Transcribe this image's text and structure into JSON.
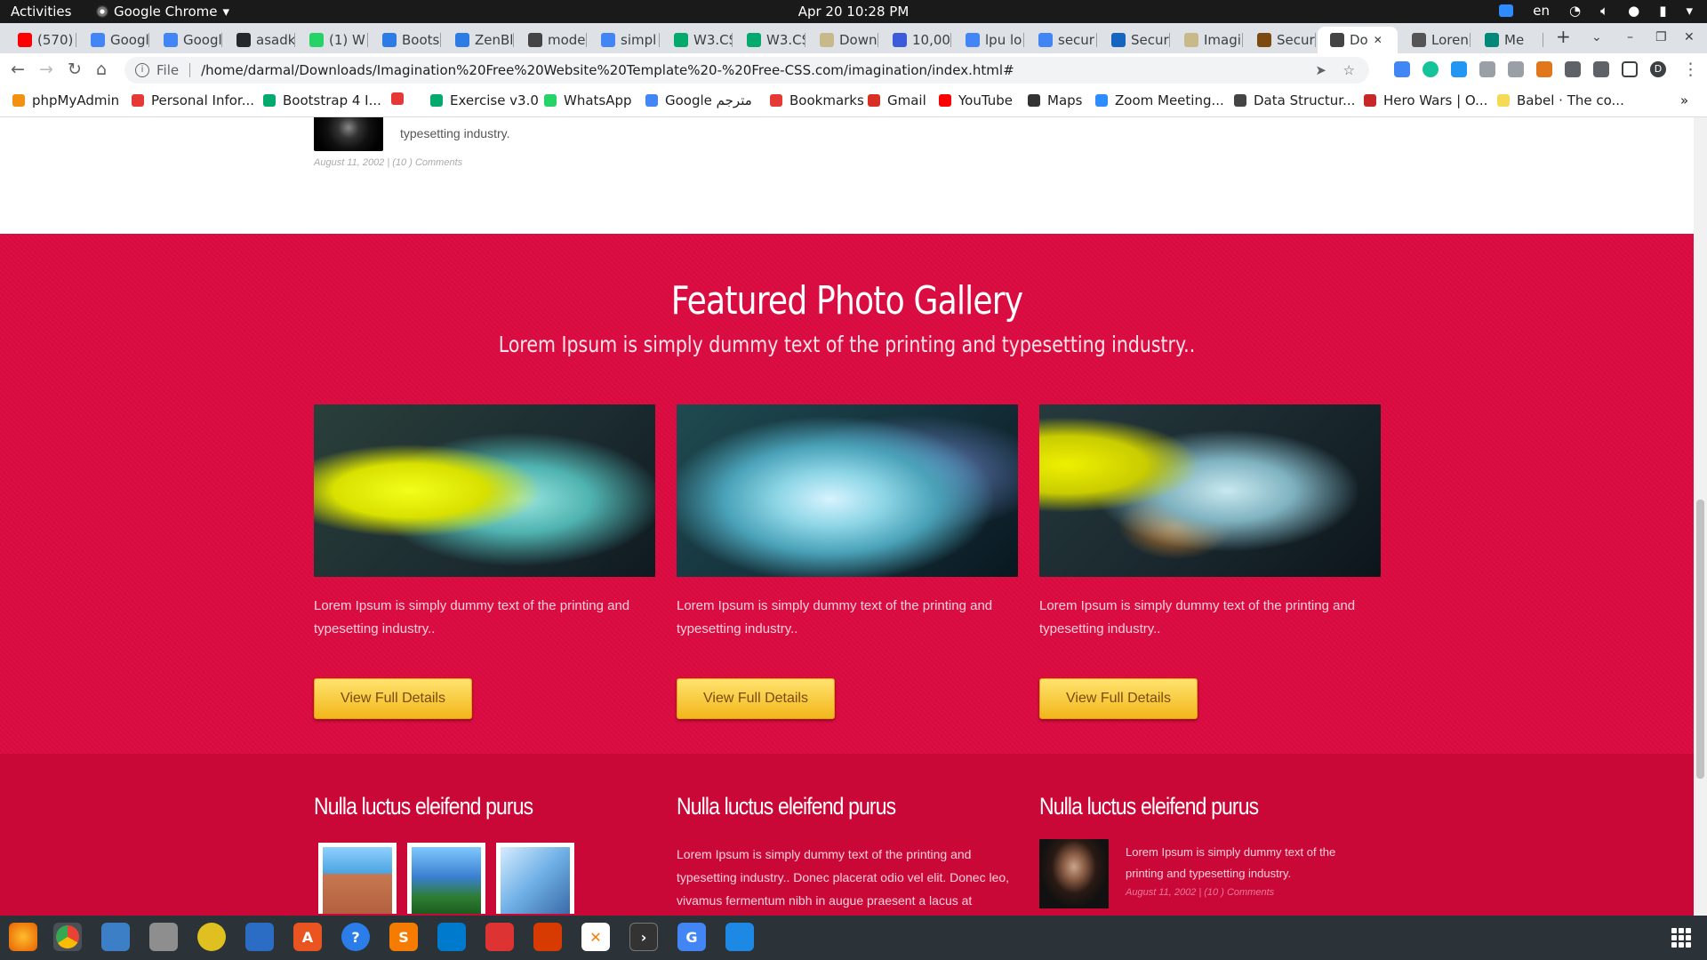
{
  "system": {
    "activities": "Activities",
    "app_name": "Google Chrome",
    "clock": "Apr 20  10:28 PM",
    "lang": "en"
  },
  "tabs": [
    {
      "label": "(570)",
      "fav": "youtube-icon",
      "color": "#ff0000"
    },
    {
      "label": "Googl",
      "fav": "translate-icon",
      "color": "#4285f4"
    },
    {
      "label": "Googl",
      "fav": "translate-icon",
      "color": "#4285f4"
    },
    {
      "label": "asadk",
      "fav": "github-icon",
      "color": "#24292e"
    },
    {
      "label": "(1) W",
      "fav": "whatsapp-icon",
      "color": "#25d366"
    },
    {
      "label": "Boots",
      "fav": "bootstrap-icon",
      "color": "#2d7be5"
    },
    {
      "label": "ZenBl",
      "fav": "zen-icon",
      "color": "#2d7be5"
    },
    {
      "label": "mode",
      "fav": "globe-icon",
      "color": "#444"
    },
    {
      "label": "simpl",
      "fav": "google-icon",
      "color": "#4285f4"
    },
    {
      "label": "W3.CS",
      "fav": "w3-icon",
      "color": "#04aa6d"
    },
    {
      "label": "W3.CS",
      "fav": "w3-icon",
      "color": "#04aa6d"
    },
    {
      "label": "Down",
      "fav": "folder-icon",
      "color": "#c8b98a"
    },
    {
      "label": "10,00",
      "fav": "n-icon",
      "color": "#3b5bdb"
    },
    {
      "label": "lpu lo",
      "fav": "google-icon",
      "color": "#4285f4"
    },
    {
      "label": "secur",
      "fav": "google-icon",
      "color": "#4285f4"
    },
    {
      "label": "Secur",
      "fav": "shield-icon",
      "color": "#1565c0"
    },
    {
      "label": "Imagi",
      "fav": "folder-icon",
      "color": "#c8b98a"
    },
    {
      "label": "Secur",
      "fav": "book-icon",
      "color": "#7a4a10"
    },
    {
      "label": "Do",
      "fav": "globe-icon",
      "color": "#444",
      "active": true
    },
    {
      "label": "Loren",
      "fav": "l-icon",
      "color": "#555"
    },
    {
      "label": "Me",
      "fav": "meet-icon",
      "color": "#00897b"
    }
  ],
  "address": {
    "scheme": "File",
    "url": "/home/darmal/Downloads/Imagination%20Free%20Website%20Template%20-%20Free-CSS.com/imagination/index.html#"
  },
  "bookmarks": [
    {
      "label": "phpMyAdmin",
      "color": "#f29111"
    },
    {
      "label": "Personal Infor...",
      "color": "#e53935"
    },
    {
      "label": "Bootstrap 4 I...",
      "color": "#04aa6d"
    },
    {
      "label": "",
      "color": "#e53935"
    },
    {
      "label": "Exercise v3.0",
      "color": "#04aa6d"
    },
    {
      "label": "WhatsApp",
      "color": "#25d366"
    },
    {
      "label": "Google مترجم",
      "color": "#4285f4"
    },
    {
      "label": "Bookmarks",
      "color": "#e53935"
    },
    {
      "label": "Gmail",
      "color": "#d93025"
    },
    {
      "label": "YouTube",
      "color": "#ff0000"
    },
    {
      "label": "Maps",
      "color": "#333"
    },
    {
      "label": "Zoom Meeting...",
      "color": "#2d8cff"
    },
    {
      "label": "Data Structur...",
      "color": "#444"
    },
    {
      "label": "Hero Wars | O...",
      "color": "#c62828"
    },
    {
      "label": "Babel · The co...",
      "color": "#f5da55"
    }
  ],
  "page": {
    "prev_post_text": "typesetting industry.",
    "prev_post_meta": "August 11, 2002 | (10 ) Comments",
    "gallery": {
      "title": "Featured Photo Gallery",
      "subtitle": "Lorem Ipsum is simply dummy text of the printing and typesetting industry..",
      "cards": [
        {
          "text": "Lorem Ipsum is simply dummy text of the printing and typesetting industry..",
          "button": "View Full Details"
        },
        {
          "text": "Lorem Ipsum is simply dummy text of the printing and typesetting industry..",
          "button": "View Full Details"
        },
        {
          "text": "Lorem Ipsum is simply dummy text of the printing and typesetting industry..",
          "button": "View Full Details"
        }
      ]
    },
    "lower": {
      "col1_title": "Nulla luctus eleifend purus",
      "col2_title": "Nulla luctus eleifend purus",
      "col2_text": "Lorem Ipsum is simply dummy text of the printing and typesetting industry.. Donec placerat odio vel elit. Donec leo, vivamus fermentum nibh in augue praesent a lacus at",
      "col3_title": "Nulla luctus eleifend purus",
      "col3_text": "Lorem Ipsum is simply dummy text of the printing and typesetting industry.",
      "col3_meta": "August 11, 2002 | (10 ) Comments"
    }
  },
  "colors": {
    "gallery_bg": "#d90a3f",
    "lower_bg": "#c90838",
    "button": "#f7c52f"
  }
}
